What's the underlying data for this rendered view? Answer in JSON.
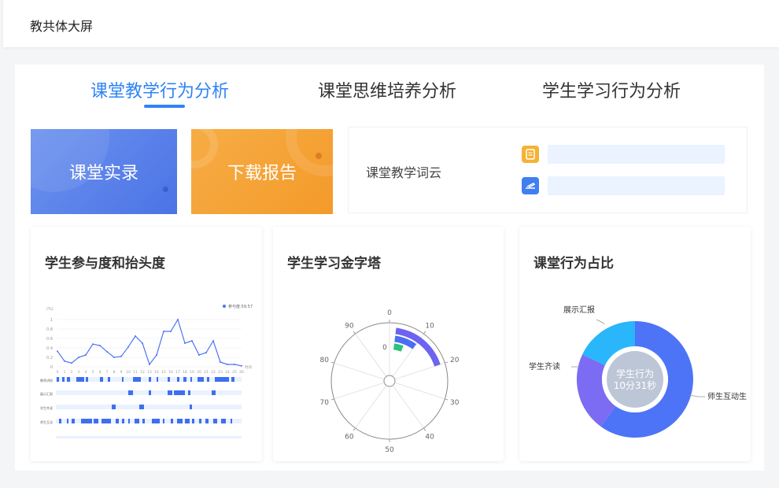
{
  "app": {
    "title": "教共体大屏"
  },
  "tabs": [
    {
      "label": "课堂教学行为分析",
      "active": true
    },
    {
      "label": "课堂思维培养分析",
      "active": false
    },
    {
      "label": "学生学习行为分析",
      "active": false
    }
  ],
  "actions": {
    "record_label": "课堂实录",
    "download_label": "下载报告"
  },
  "wordcloud": {
    "label": "课堂教学词云",
    "icons": [
      "document-icon",
      "airplane-icon"
    ],
    "accent_blue": "#2f84f5"
  },
  "panels": {
    "participation": {
      "title": "学生参与度和抬头度"
    },
    "pyramid": {
      "title": "学生学习金字塔"
    },
    "behavior": {
      "title": "课堂行为占比"
    }
  },
  "chart_data": [
    {
      "type": "line",
      "legend": "参与度:59.57",
      "ylabel": "(%)",
      "ylim": [
        0,
        1
      ],
      "yticks": [
        "1",
        "0.8",
        "0.6",
        "0.4",
        "0.2",
        "0"
      ],
      "x": [
        0,
        1,
        2,
        3,
        4,
        5,
        6,
        7,
        8,
        9,
        10,
        11,
        12,
        13,
        14,
        15,
        16,
        17,
        18,
        19,
        20,
        21,
        22,
        23,
        24,
        25,
        26
      ],
      "xlabel_end": "时间",
      "values": [
        0.33,
        0.12,
        0.08,
        0.2,
        0.25,
        0.48,
        0.45,
        0.32,
        0.2,
        0.22,
        0.42,
        0.65,
        0.5,
        0.05,
        0.25,
        0.75,
        0.75,
        1.0,
        0.5,
        0.55,
        0.25,
        0.3,
        0.55,
        0.1,
        0.05,
        0.05,
        0.02
      ],
      "rows": [
        "教师讲授",
        "展示汇报",
        "学生齐读",
        "师生互动"
      ]
    },
    {
      "type": "polar",
      "angle_ticks": [
        "0",
        "10",
        "20",
        "30",
        "40",
        "50",
        "60",
        "70",
        "80",
        "90"
      ],
      "radial_label": "0",
      "series_colors": [
        "#6c63f0",
        "#4c6ef5",
        "#2fc17b"
      ]
    },
    {
      "type": "pie",
      "center_label": "学生行为 10分31秒",
      "slices": [
        {
          "name": "师生互动生",
          "value": 60,
          "color": "#4d74f7"
        },
        {
          "name": "学生齐读",
          "value": 22,
          "color": "#7b6cf3"
        },
        {
          "name": "展示汇报",
          "value": 18,
          "color": "#29b6fb"
        }
      ]
    }
  ]
}
